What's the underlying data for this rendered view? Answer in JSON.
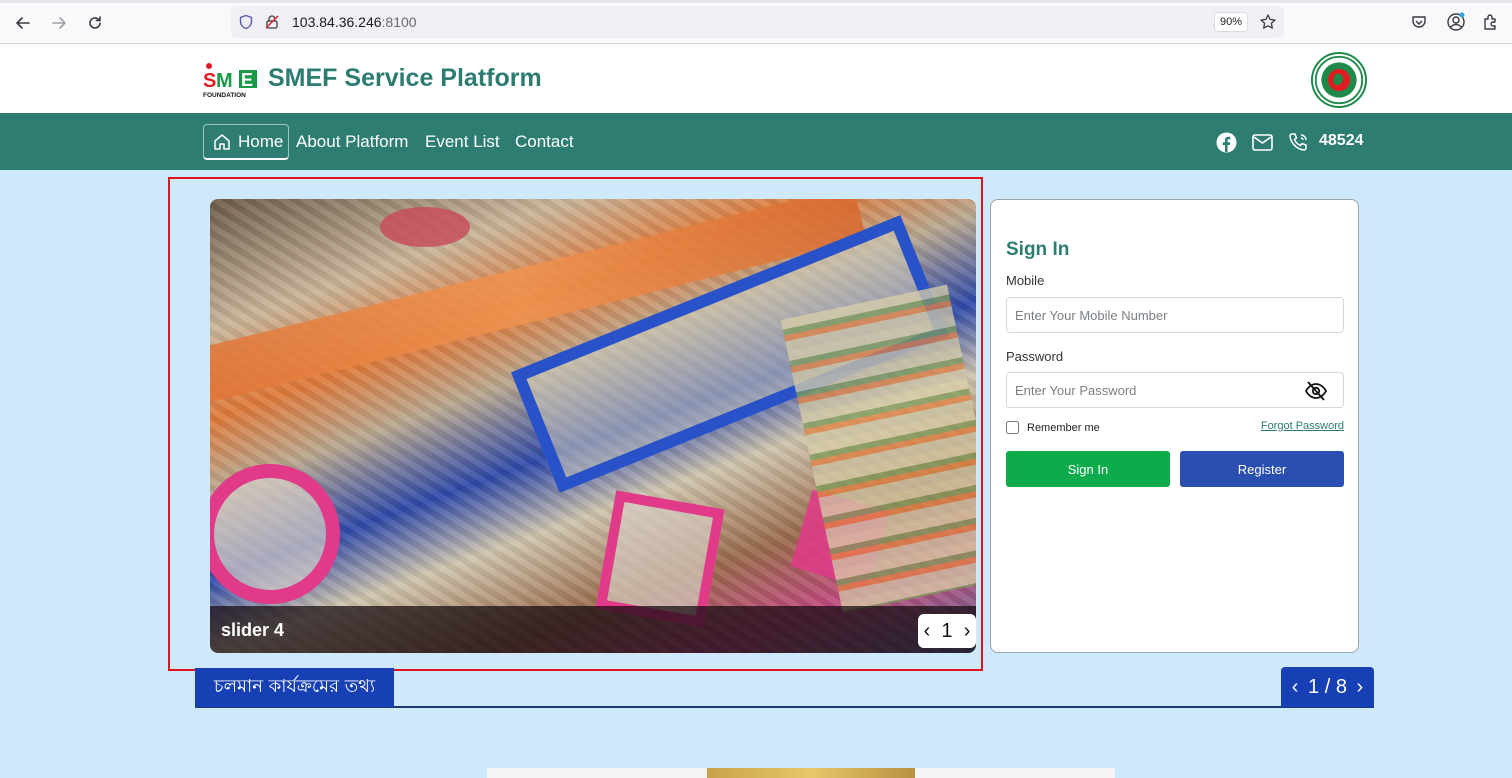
{
  "browser": {
    "url_host": "103.84.36.246",
    "url_port": ":8100",
    "zoom": "90%"
  },
  "header": {
    "logo_text": "SME FOUNDATION",
    "title": "SMEF Service Platform"
  },
  "nav": {
    "items": [
      {
        "label": "Home"
      },
      {
        "label": "About Platform"
      },
      {
        "label": "Event List"
      },
      {
        "label": "Contact"
      }
    ],
    "hotline": "48524"
  },
  "slider": {
    "caption": "slider 4",
    "page": "1"
  },
  "signin": {
    "title": "Sign In",
    "mobile_label": "Mobile",
    "mobile_placeholder": "Enter Your Mobile Number",
    "password_label": "Password",
    "password_placeholder": "Enter Your Password",
    "remember_label": "Remember me",
    "forgot_label": "Forgot Password",
    "signin_button": "Sign In",
    "register_button": "Register"
  },
  "notice": {
    "label": "চলমান কার্যক্রমের তথ্য",
    "pager": "1 / 8"
  },
  "colors": {
    "brand_green": "#2e7d72",
    "signin_green": "#0eab4c",
    "register_blue": "#2b4fb0",
    "notice_blue": "#1740b4",
    "page_bg": "#cde9fb"
  }
}
